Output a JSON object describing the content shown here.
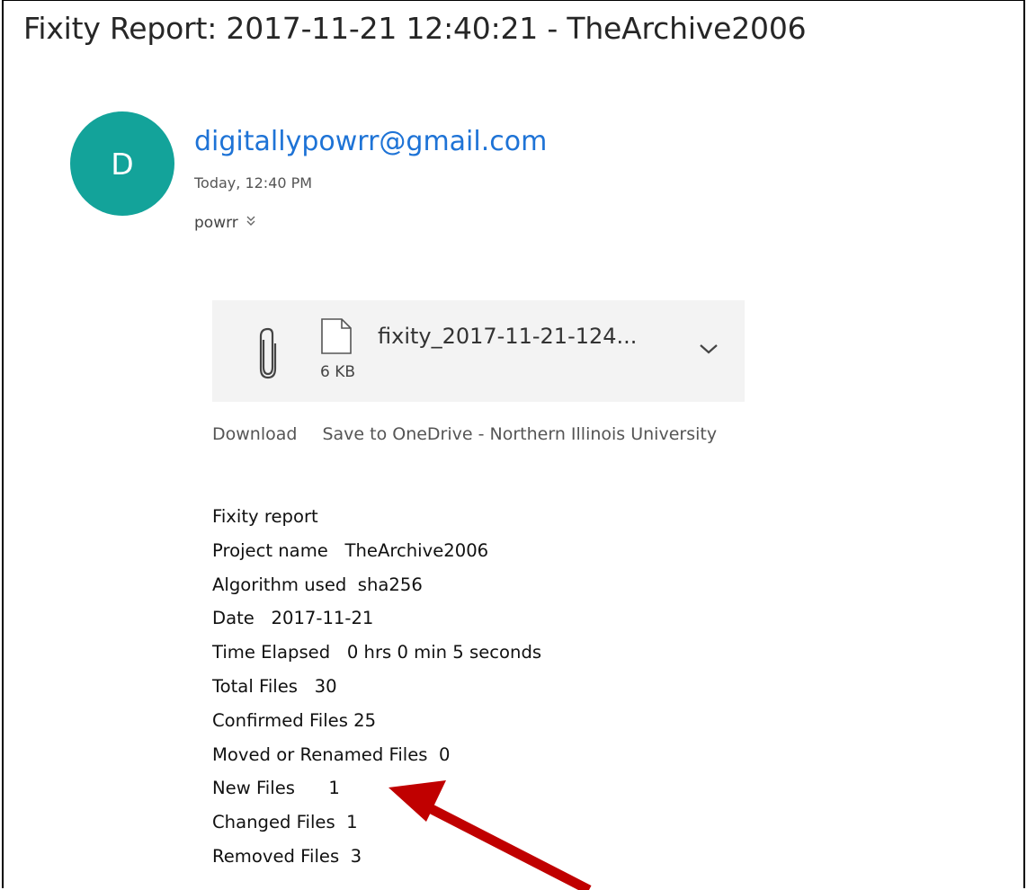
{
  "email": {
    "subject": "Fixity Report: 2017-11-21 12:40:21 - TheArchive2006",
    "avatar_letter": "D",
    "sender": "digitallypowrr@gmail.com",
    "date": "Today, 12:40 PM",
    "to": "powrr",
    "to_expand_icon": "double-chevron-down-icon"
  },
  "attachment": {
    "filename": "fixity_2017-11-21-124...",
    "size": "6 KB",
    "clip_icon": "paperclip-icon",
    "file_icon": "document-icon",
    "menu_icon": "chevron-down-icon"
  },
  "actions": {
    "download": "Download",
    "save": "Save to OneDrive - Northern Illinois University"
  },
  "report": {
    "lines": [
      "Fixity report",
      "Project name   TheArchive2006",
      "Algorithm used  sha256",
      "Date   2017-11-21",
      "Time Elapsed   0 hrs 0 min 5 seconds",
      "Total Files   30",
      "Confirmed Files 25",
      "Moved or Renamed Files  0",
      "New Files      1",
      "Changed Files  1",
      "Removed Files  3"
    ]
  },
  "colors": {
    "avatar": "#13a39a",
    "sender": "#1e73d6",
    "arrow": "#c00000"
  }
}
